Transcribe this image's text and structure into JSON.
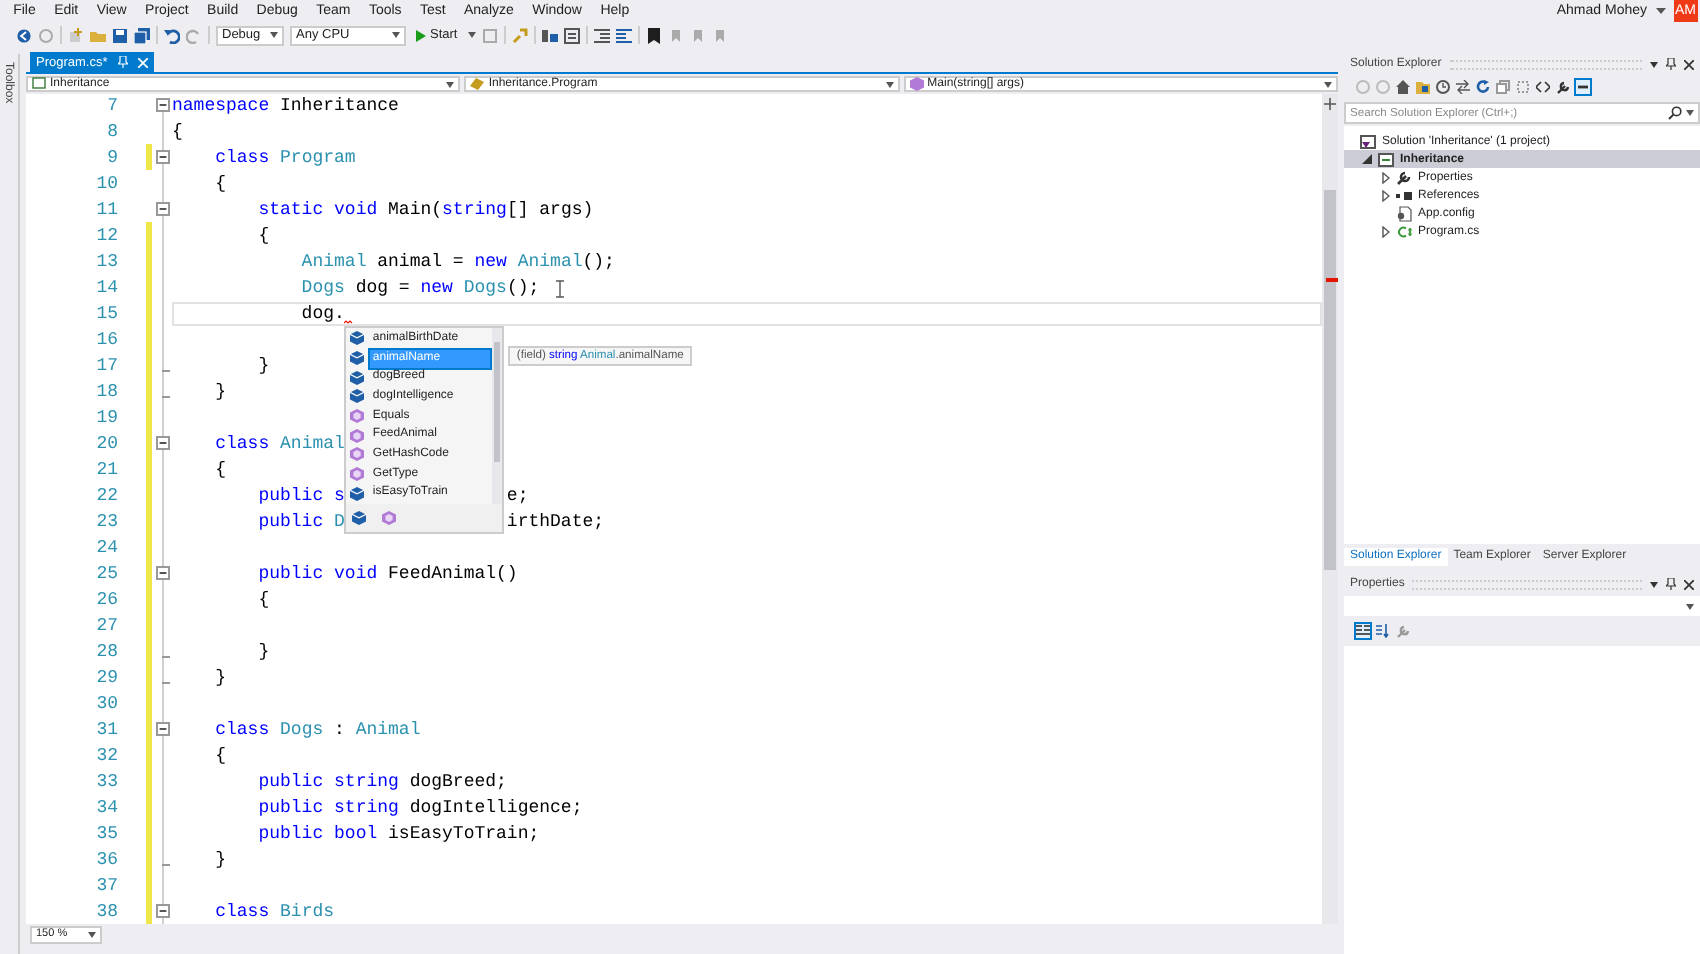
{
  "menu": [
    "File",
    "Edit",
    "View",
    "Project",
    "Build",
    "Debug",
    "Team",
    "Tools",
    "Test",
    "Analyze",
    "Window",
    "Help"
  ],
  "account": {
    "name": "Ahmad Mohey",
    "initials": "AM"
  },
  "toolbar": {
    "configuration": "Debug",
    "platform": "Any CPU",
    "start": "Start"
  },
  "side_strip": {
    "label": "Toolbox"
  },
  "tabs": [
    {
      "label": "Program.cs*",
      "selected": true
    }
  ],
  "navigation": [
    "Inheritance",
    "Inheritance.Program",
    "Main(string[] args)"
  ],
  "code_lines": [
    {
      "number": "7",
      "modified": false,
      "foldable": true,
      "tokens": [
        {
          "kind": "keyword",
          "text": "namespace"
        },
        {
          "kind": "plain",
          "text": " Inheritance"
        }
      ]
    },
    {
      "number": "8",
      "modified": false,
      "tokens": [
        {
          "kind": "plain",
          "text": "{"
        }
      ]
    },
    {
      "number": "9",
      "modified": true,
      "foldable": true,
      "tokens": [
        {
          "kind": "keyword",
          "text": "    class "
        },
        {
          "kind": "type",
          "text": "Program"
        }
      ]
    },
    {
      "number": "10",
      "modified": false,
      "tokens": [
        {
          "kind": "plain",
          "text": "    {"
        }
      ]
    },
    {
      "number": "11",
      "modified": false,
      "foldable": true,
      "tokens": [
        {
          "kind": "keyword",
          "text": "        static void"
        },
        {
          "kind": "plain",
          "text": " Main("
        },
        {
          "kind": "keyword",
          "text": "string"
        },
        {
          "kind": "plain",
          "text": "[] args)"
        }
      ]
    },
    {
      "number": "12",
      "modified": true,
      "tokens": [
        {
          "kind": "plain",
          "text": "        {"
        }
      ]
    },
    {
      "number": "13",
      "modified": true,
      "tokens": [
        {
          "kind": "type",
          "text": "            Animal"
        },
        {
          "kind": "plain",
          "text": " animal = "
        },
        {
          "kind": "keyword",
          "text": "new "
        },
        {
          "kind": "type",
          "text": "Animal"
        },
        {
          "kind": "plain",
          "text": "();"
        }
      ]
    },
    {
      "number": "14",
      "modified": true,
      "mouse_cursor": true,
      "tokens": [
        {
          "kind": "type",
          "text": "            Dogs"
        },
        {
          "kind": "plain",
          "text": " dog = "
        },
        {
          "kind": "keyword",
          "text": "new "
        },
        {
          "kind": "type",
          "text": "Dogs"
        },
        {
          "kind": "plain",
          "text": "();"
        }
      ]
    },
    {
      "number": "15",
      "modified": true,
      "current": true,
      "error_mark": true,
      "tokens": [
        {
          "kind": "plain",
          "text": "            dog."
        }
      ]
    },
    {
      "number": "16",
      "modified": true
    },
    {
      "number": "17",
      "modified": true,
      "block_end": true,
      "tokens": [
        {
          "kind": "plain",
          "text": "        }"
        }
      ]
    },
    {
      "number": "18",
      "modified": true,
      "block_end": true,
      "tokens": [
        {
          "kind": "plain",
          "text": "    }"
        }
      ]
    },
    {
      "number": "19",
      "modified": true
    },
    {
      "number": "20",
      "modified": true,
      "foldable": true,
      "tokens": [
        {
          "kind": "keyword",
          "text": "    class "
        },
        {
          "kind": "type",
          "text": "Animal"
        }
      ]
    },
    {
      "number": "21",
      "modified": true,
      "tokens": [
        {
          "kind": "plain",
          "text": "    {"
        }
      ]
    },
    {
      "number": "22",
      "modified": true,
      "tokens": [
        {
          "kind": "keyword",
          "text": "        public s"
        }
      ],
      "tail": "e;"
    },
    {
      "number": "23",
      "modified": true,
      "tokens": [
        {
          "kind": "keyword",
          "text": "        public "
        },
        {
          "kind": "type",
          "text": "D"
        }
      ],
      "tail": "irthDate;"
    },
    {
      "number": "24",
      "modified": true
    },
    {
      "number": "25",
      "modified": true,
      "foldable": true,
      "tokens": [
        {
          "kind": "keyword",
          "text": "        public void"
        },
        {
          "kind": "plain",
          "text": " FeedAnimal()"
        }
      ]
    },
    {
      "number": "26",
      "modified": true,
      "tokens": [
        {
          "kind": "plain",
          "text": "        {"
        }
      ]
    },
    {
      "number": "27",
      "modified": true
    },
    {
      "number": "28",
      "modified": true,
      "block_end": true,
      "tokens": [
        {
          "kind": "plain",
          "text": "        }"
        }
      ]
    },
    {
      "number": "29",
      "modified": true,
      "block_end": true,
      "tokens": [
        {
          "kind": "plain",
          "text": "    }"
        }
      ]
    },
    {
      "number": "30",
      "modified": true
    },
    {
      "number": "31",
      "modified": true,
      "foldable": true,
      "tokens": [
        {
          "kind": "keyword",
          "text": "    class "
        },
        {
          "kind": "type",
          "text": "Dogs"
        },
        {
          "kind": "plain",
          "text": " : "
        },
        {
          "kind": "type",
          "text": "Animal"
        }
      ]
    },
    {
      "number": "32",
      "modified": true,
      "tokens": [
        {
          "kind": "plain",
          "text": "    {"
        }
      ]
    },
    {
      "number": "33",
      "modified": true,
      "tokens": [
        {
          "kind": "keyword",
          "text": "        public string"
        },
        {
          "kind": "plain",
          "text": " dogBreed;"
        }
      ]
    },
    {
      "number": "34",
      "modified": true,
      "tokens": [
        {
          "kind": "keyword",
          "text": "        public string"
        },
        {
          "kind": "plain",
          "text": " dogIntelligence;"
        }
      ]
    },
    {
      "number": "35",
      "modified": true,
      "tokens": [
        {
          "kind": "keyword",
          "text": "        public bool"
        },
        {
          "kind": "plain",
          "text": " isEasyToTrain;"
        }
      ]
    },
    {
      "number": "36",
      "modified": true,
      "block_end": true,
      "tokens": [
        {
          "kind": "plain",
          "text": "    }"
        }
      ]
    },
    {
      "number": "37",
      "modified": true
    },
    {
      "number": "38",
      "modified": true,
      "foldable": true,
      "tokens": [
        {
          "kind": "keyword",
          "text": "    class "
        },
        {
          "kind": "type",
          "text": "Birds"
        }
      ]
    }
  ],
  "completion": {
    "items": [
      {
        "label": "animalBirthDate",
        "kind": "field",
        "selected": false
      },
      {
        "label": "animalName",
        "kind": "field",
        "selected": true
      },
      {
        "label": "dogBreed",
        "kind": "field",
        "selected": false
      },
      {
        "label": "dogIntelligence",
        "kind": "field",
        "selected": false
      },
      {
        "label": "Equals",
        "kind": "method",
        "selected": false
      },
      {
        "label": "FeedAnimal",
        "kind": "method",
        "selected": false
      },
      {
        "label": "GetHashCode",
        "kind": "method",
        "selected": false
      },
      {
        "label": "GetType",
        "kind": "method",
        "selected": false
      },
      {
        "label": "isEasyToTrain",
        "kind": "field",
        "selected": false
      }
    ],
    "tooltip": [
      {
        "kind": "plain",
        "text": "(field) "
      },
      {
        "kind": "keyword",
        "text": "string "
      },
      {
        "kind": "type",
        "text": "Animal"
      },
      {
        "kind": "plain",
        "text": ".animalName"
      }
    ]
  },
  "zoom": "150 %",
  "solution_explorer": {
    "title": "Solution Explorer",
    "search": {
      "placeholder": "Search Solution Explorer (Ctrl+;)"
    },
    "tree": [
      {
        "label": "Solution 'Inheritance' (1 project)",
        "kind": "solution",
        "selected": false,
        "children": [
          {
            "label": "Inheritance",
            "kind": "project",
            "selected": true,
            "expanded": true,
            "children": [
              {
                "label": "Properties",
                "kind": "properties",
                "selected": false,
                "expanded": false
              },
              {
                "label": "References",
                "kind": "references",
                "selected": false,
                "expanded": false
              },
              {
                "label": "App.config",
                "kind": "config",
                "selected": false
              },
              {
                "label": "Program.cs",
                "kind": "csharp",
                "selected": false,
                "expanded": false
              }
            ]
          }
        ]
      }
    ],
    "tabs": [
      {
        "label": "Solution Explorer",
        "selected": true
      },
      {
        "label": "Team Explorer",
        "selected": false
      },
      {
        "label": "Server Explorer",
        "selected": false
      }
    ]
  },
  "properties": {
    "title": "Properties"
  }
}
